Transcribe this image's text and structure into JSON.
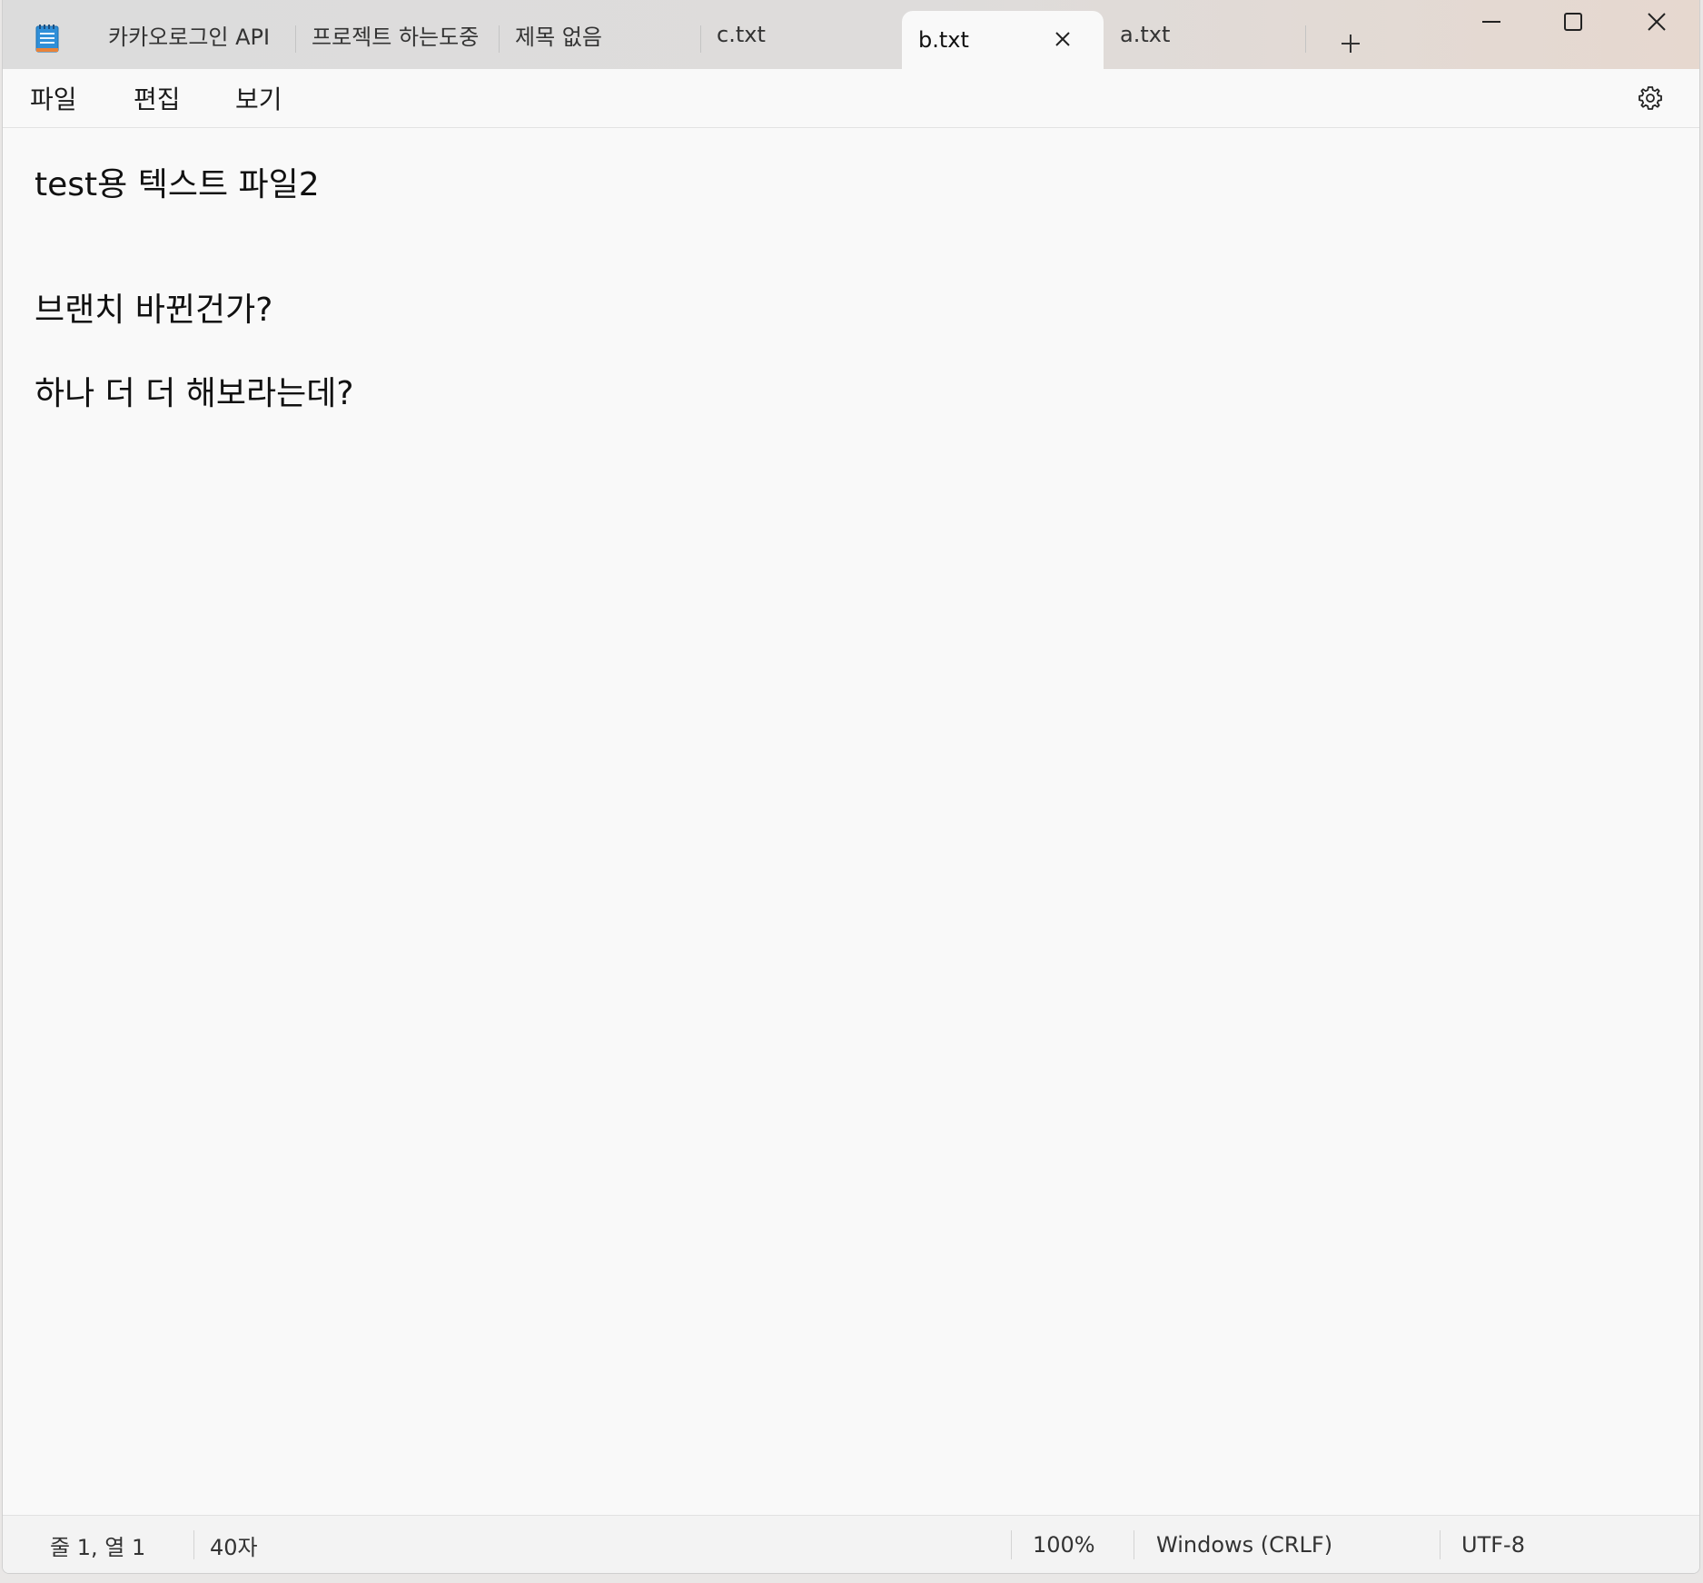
{
  "window": {
    "tabs": [
      {
        "label": "카카오로그인 API",
        "active": false
      },
      {
        "label": "프로젝트 하는도중",
        "active": false
      },
      {
        "label": "제목 없음",
        "active": false
      },
      {
        "label": "c.txt",
        "active": false
      },
      {
        "label": "b.txt",
        "active": true
      },
      {
        "label": "a.txt",
        "active": false
      }
    ],
    "controls": {
      "new_tab_icon": "plus-icon",
      "close_tab_icon": "close-icon",
      "minimize_icon": "minimize-icon",
      "maximize_icon": "maximize-icon",
      "close_window_icon": "close-icon"
    }
  },
  "menu": {
    "items": [
      "파일",
      "편집",
      "보기"
    ],
    "settings_icon": "gear-icon"
  },
  "editor": {
    "lines": [
      "test용 텍스트 파일2",
      "",
      "브랜치 바뀐건가?",
      "",
      "하나 더 더 해보라는데?"
    ]
  },
  "status": {
    "position": "줄 1, 열 1",
    "char_count": "40자",
    "zoom": "100%",
    "line_ending": "Windows (CRLF)",
    "encoding": "UTF-8"
  }
}
